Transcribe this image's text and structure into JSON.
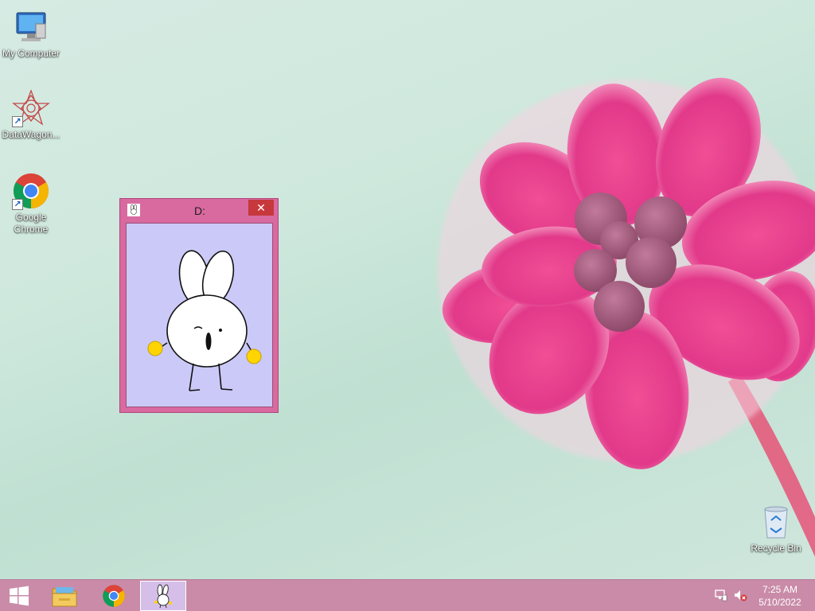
{
  "desktop": {
    "icons": [
      {
        "label": "My Computer",
        "icon": "computer-icon"
      },
      {
        "label": "DataWagon...",
        "icon": "datawagon-icon"
      },
      {
        "label": "Google Chrome",
        "icon": "chrome-icon"
      },
      {
        "label": "Recycle Bin",
        "icon": "recycle-bin-icon"
      }
    ]
  },
  "window": {
    "title": "D:",
    "close_glyph": "✕",
    "content": "bunny-drawing"
  },
  "taskbar": {
    "start": "windows-start-icon",
    "apps": [
      {
        "name": "file-explorer",
        "icon": "folder-icon"
      },
      {
        "name": "google-chrome",
        "icon": "chrome-icon"
      },
      {
        "name": "bunny-app",
        "icon": "bunny-icon",
        "active": true
      }
    ],
    "tray": {
      "network": "network-icon",
      "volume": "speaker-muted-icon"
    },
    "clock": {
      "time": "7:25 AM",
      "date": "5/10/2022"
    }
  },
  "colors": {
    "window_frame": "#d86aa0",
    "window_client": "#cbc9f7",
    "close_button": "#c7383d",
    "taskbar": "#c98ba8",
    "flower": "#e0448a"
  }
}
